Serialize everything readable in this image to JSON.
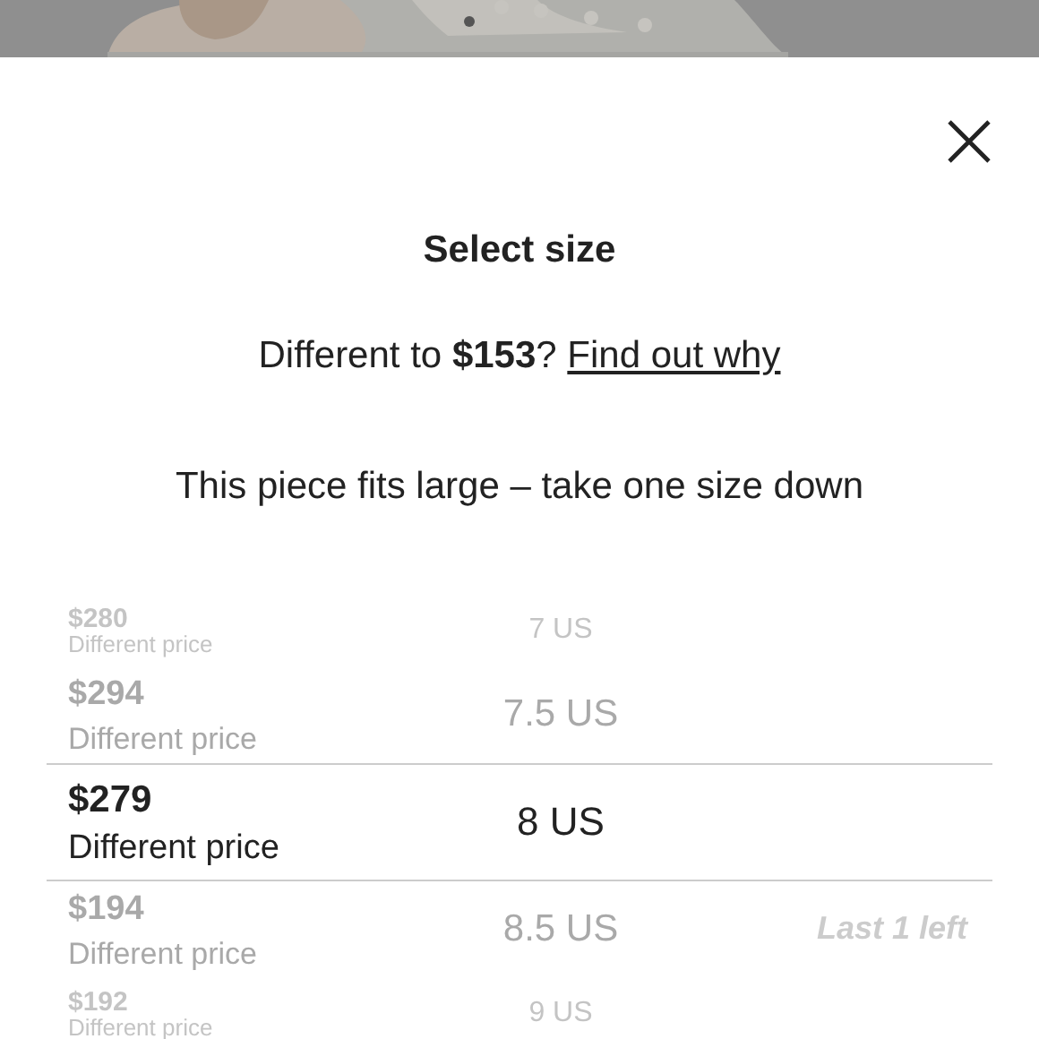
{
  "sheet": {
    "title": "Select size",
    "price_note": {
      "prefix": "Different to ",
      "price": "$153",
      "suffix": "?",
      "link": "Find out why"
    },
    "fit_note": "This piece fits large – take one size down"
  },
  "sizes": [
    {
      "price": "$280",
      "note": "Different price",
      "size": "7 US",
      "selected": false
    },
    {
      "price": "$294",
      "note": "Different price",
      "size": "7.5 US",
      "selected": false
    },
    {
      "price": "$279",
      "note": "Different price",
      "size": "8 US",
      "selected": true
    },
    {
      "price": "$194",
      "note": "Different price",
      "size": "8.5 US",
      "stock": "Last 1 left",
      "selected": false
    },
    {
      "price": "$192",
      "note": "Different price",
      "size": "9 US",
      "selected": false
    }
  ]
}
